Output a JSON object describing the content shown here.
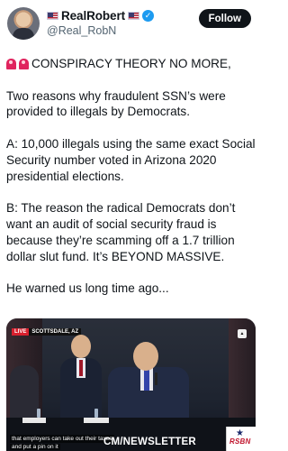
{
  "author": {
    "display_name": "RealRobert",
    "handle": "@Real_RobN",
    "verified": true,
    "flag_icon": "us-flag-icon",
    "verified_color": "#1d9bf0"
  },
  "follow_label": "Follow",
  "post": {
    "line1": "CONSPIRACY THEORY NO MORE,",
    "paragraph1": "Two reasons why fraudulent SSN’s were provided to illegals by Democrats.",
    "paragraph2": "A: 10,000 illegals using the same exact Social Security number voted in Arizona 2020 presidential elections.",
    "paragraph3": "B: The reason the radical Democrats don’t want an audit of social security fraud is because they’re scamming off a 1.7 trillion dollar slut fund. It’s BEYOND MASSIVE.",
    "paragraph4": "He warned us long time ago..."
  },
  "video": {
    "live_label": "LIVE",
    "location_label": "SCOTTSDALE, AZ",
    "caption_line1": "that employers can take out their taxes",
    "caption_line2": "and put a pin on it",
    "ticker": "CM/NEWSLETTER",
    "network_logo": "RSBN"
  }
}
